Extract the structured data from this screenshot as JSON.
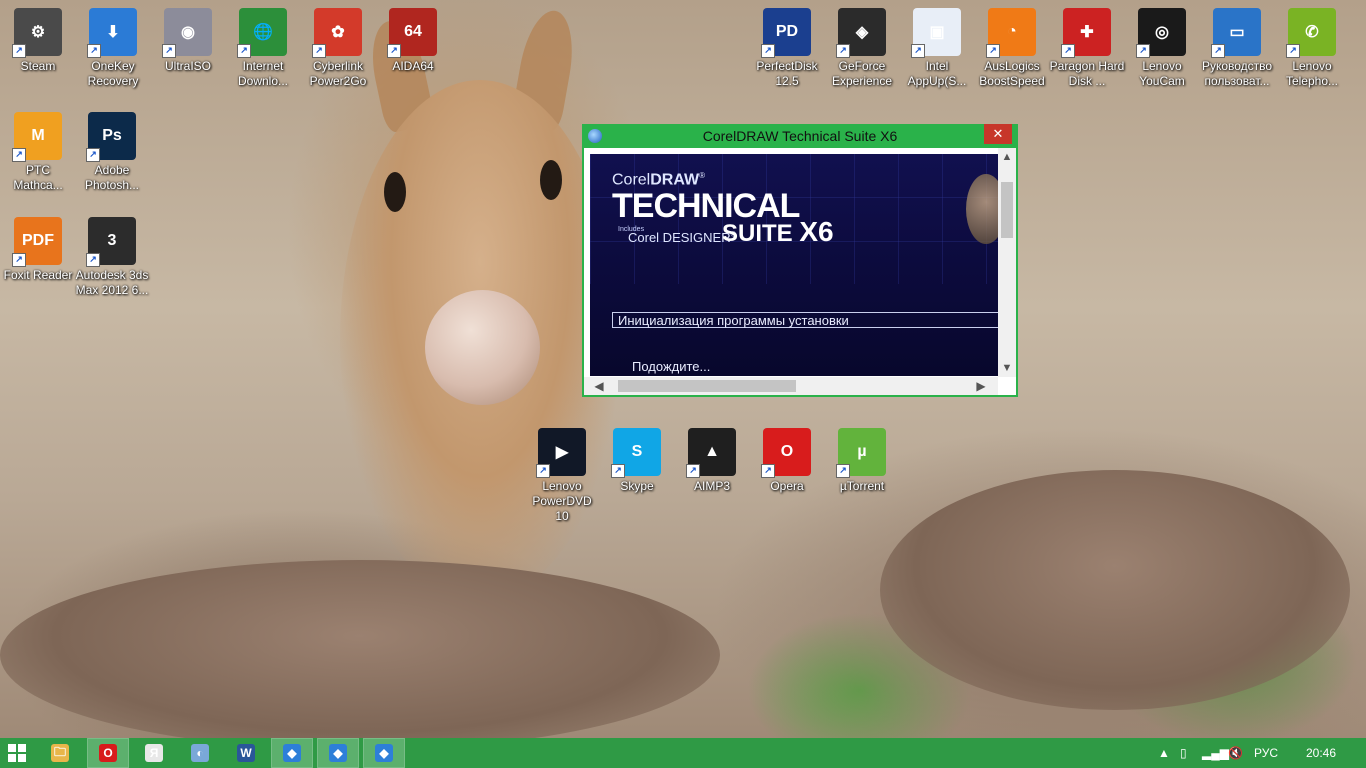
{
  "desktop": {
    "icons_top_left": [
      {
        "label": "Steam",
        "icon": "steam-icon",
        "color": "#4a4a4a",
        "glyph": "⚙"
      },
      {
        "label": "OneKey Recovery",
        "icon": "onekey-recovery-icon",
        "color": "#2b7bd6",
        "glyph": "⬇"
      },
      {
        "label": "UltraISO",
        "icon": "ultraiso-icon",
        "color": "#8c8c9a",
        "glyph": "◉"
      },
      {
        "label": "Internet Downlo...",
        "icon": "internet-download-manager-icon",
        "color": "#2c8f3a",
        "glyph": "🌐"
      },
      {
        "label": "Cyberlink Power2Go",
        "icon": "power2go-icon",
        "color": "#d33a2a",
        "glyph": "✿"
      },
      {
        "label": "AIDA64",
        "icon": "aida64-icon",
        "color": "#b0261f",
        "glyph": "64"
      }
    ],
    "icons_left_col": [
      {
        "label": "PTC Mathca...",
        "icon": "mathcad-icon",
        "color": "#f0a020",
        "glyph": "M"
      },
      {
        "label": "Adobe Photosh...",
        "icon": "photoshop-icon",
        "color": "#0c2a4a",
        "glyph": "Ps"
      },
      {
        "label": "Foxit Reader",
        "icon": "foxit-reader-icon",
        "color": "#e8741c",
        "glyph": "PDF"
      },
      {
        "label": "Autodesk 3ds Max 2012 6...",
        "icon": "3ds-max-icon",
        "color": "#2c2c2c",
        "glyph": "3"
      }
    ],
    "icons_top_right": [
      {
        "label": "PerfectDisk 12.5",
        "icon": "perfectdisk-icon",
        "color": "#1b3f8f",
        "glyph": "PD"
      },
      {
        "label": "GeForce Experience",
        "icon": "geforce-experience-icon",
        "color": "#2b2b2b",
        "glyph": "◈"
      },
      {
        "label": "Intel AppUp(S...",
        "icon": "intel-appup-icon",
        "color": "#e8eef7",
        "glyph": "▣"
      },
      {
        "label": "AusLogics BoostSpeed",
        "icon": "boostspeed-icon",
        "color": "#f07a16",
        "glyph": "◔"
      },
      {
        "label": "Paragon Hard Disk ...",
        "icon": "paragon-icon",
        "color": "#cc2222",
        "glyph": "✚"
      },
      {
        "label": "Lenovo YouCam",
        "icon": "youcam-icon",
        "color": "#1a1a1a",
        "glyph": "◎"
      },
      {
        "label": "Руководство пользоват...",
        "icon": "user-guide-icon",
        "color": "#2a74c8",
        "glyph": "▭"
      },
      {
        "label": "Lenovo Telepho...",
        "icon": "telephony-icon",
        "color": "#7ab324",
        "glyph": "✆"
      }
    ],
    "icons_middle": [
      {
        "label": "Lenovo PowerDVD 10",
        "icon": "powerdvd-icon",
        "color": "#111827",
        "glyph": "▶"
      },
      {
        "label": "Skype",
        "icon": "skype-icon",
        "color": "#10a6e6",
        "glyph": "S"
      },
      {
        "label": "AIMP3",
        "icon": "aimp3-icon",
        "color": "#1f1f1f",
        "glyph": "▲"
      },
      {
        "label": "Opera",
        "icon": "opera-icon",
        "color": "#d81c1c",
        "glyph": "O"
      },
      {
        "label": "µTorrent",
        "icon": "utorrent-icon",
        "color": "#62b33c",
        "glyph": "µ"
      }
    ]
  },
  "installer_window": {
    "title": "CorelDRAW Technical Suite X6",
    "close_glyph": "✕",
    "splash": {
      "brand_prefix": "Corel",
      "brand_name": "DRAW",
      "brand_mark": "®",
      "headline": "TECHNICAL",
      "includes": "Includes",
      "designer": "Corel DESIGNER",
      "designer_mark": "®",
      "suite": "SUITE",
      "version": "X6"
    },
    "status_text": "Инициализация программы установки",
    "wait_text": "Подождите..."
  },
  "taskbar": {
    "accent": "#2f9a45",
    "pinned": [
      {
        "name": "explorer-icon",
        "glyph": "🗀",
        "color": "#e8b64a",
        "active": false
      },
      {
        "name": "opera-taskbar-icon",
        "glyph": "O",
        "color": "#d81c1c",
        "active": true
      },
      {
        "name": "yandex-icon",
        "glyph": "Я",
        "color": "#e8e8e8",
        "active": false
      },
      {
        "name": "speaker-app-icon",
        "glyph": "◐",
        "color": "#7aa8d8",
        "active": false
      },
      {
        "name": "word-icon",
        "glyph": "W",
        "color": "#2a5699",
        "active": false
      },
      {
        "name": "installer-task-1-icon",
        "glyph": "◆",
        "color": "#2d7fd8",
        "active": true
      },
      {
        "name": "installer-task-2-icon",
        "glyph": "◆",
        "color": "#2d7fd8",
        "active": true
      },
      {
        "name": "installer-task-3-icon",
        "glyph": "◆",
        "color": "#2d7fd8",
        "active": true
      }
    ],
    "tray": {
      "show_hidden": "▲",
      "language": "РУС",
      "time": "20:46"
    }
  }
}
